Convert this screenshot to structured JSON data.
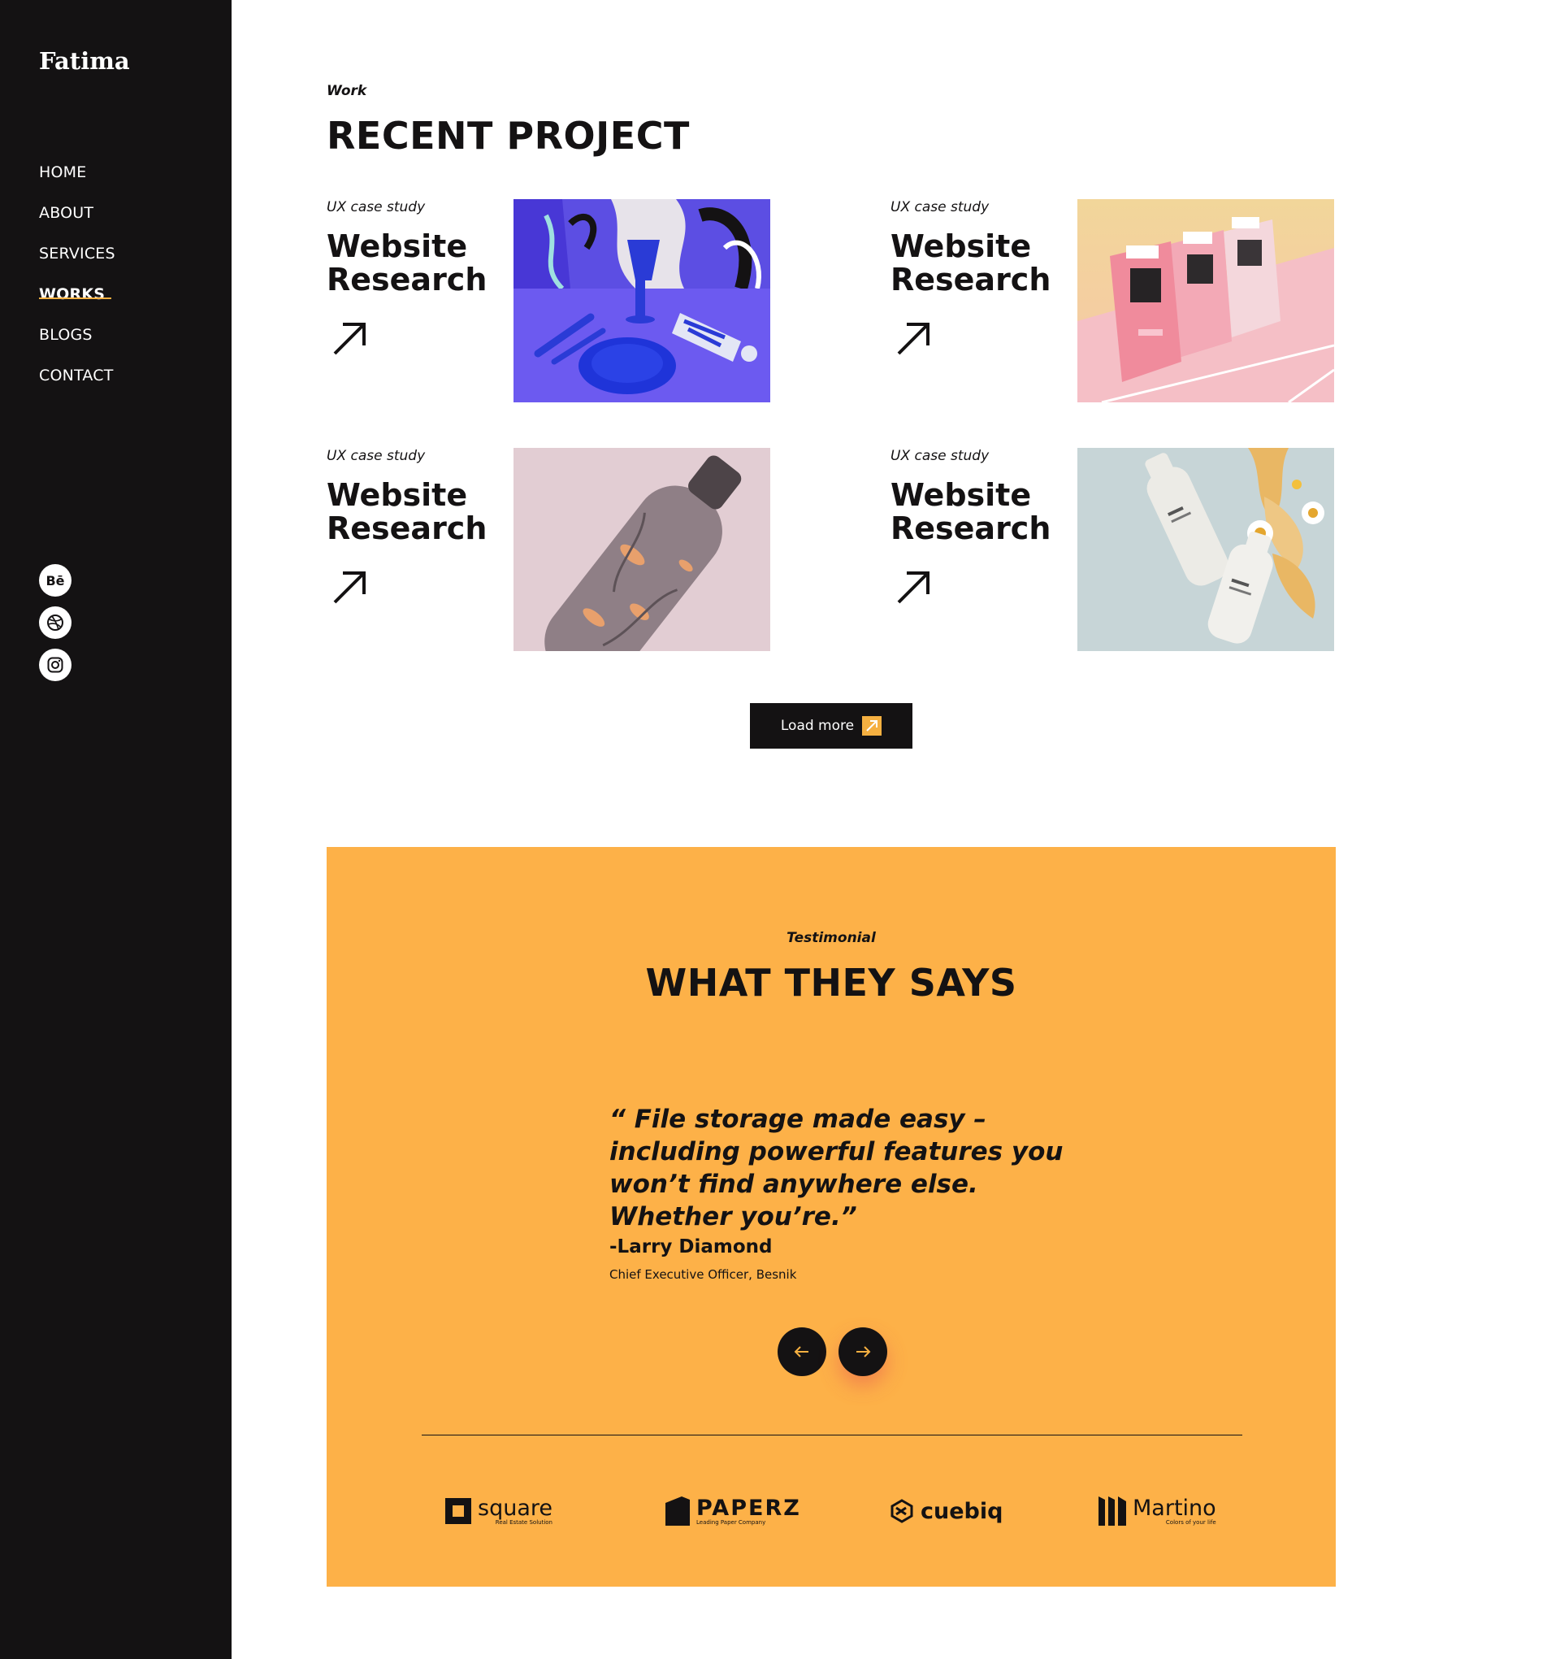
{
  "sidebar": {
    "logo": "Fatima",
    "nav": [
      "HOME",
      "ABOUT",
      "SERVICES",
      "WORKS",
      "BLOGS",
      "CONTACT"
    ],
    "active_nav": "WORKS",
    "socials": [
      {
        "label": "Bē",
        "icon": "behance-icon"
      },
      {
        "label": "",
        "icon": "dribbble-icon"
      },
      {
        "label": "",
        "icon": "instagram-icon"
      }
    ]
  },
  "work": {
    "eyebrow": "Work",
    "title": "RECENT PROJECT",
    "projects": [
      {
        "category": "UX case study",
        "title": "Website Research",
        "image": "blue-tableware-illustration"
      },
      {
        "category": "UX case study",
        "title": "Website Research",
        "image": "pink-atm-machines"
      },
      {
        "category": "UX case study",
        "title": "Website Research",
        "image": "patterned-bottle-mockup"
      },
      {
        "category": "UX case study",
        "title": "Website Research",
        "image": "cosmetic-bottles-with-flowers"
      }
    ],
    "load_more": "Load more"
  },
  "testimonial": {
    "eyebrow": "Testimonial",
    "title": "WHAT THEY SAYS",
    "quote": "“ File storage made easy – including powerful features you won’t find anywhere else. Whether you’re.”",
    "author": "-Larry Diamond",
    "role": "Chief Executive Officer, Besnik",
    "brands": [
      {
        "name": "square",
        "tagline": "Real Estate Solution"
      },
      {
        "name": "PAPERZ",
        "tagline": "Leading Paper Company"
      },
      {
        "name": "cuebiq",
        "tagline": ""
      },
      {
        "name": "Martino",
        "tagline": "Colors of your life"
      }
    ]
  },
  "colors": {
    "sidebar_bg": "#141213",
    "accent": "#f5b041",
    "testimonial_bg": "#fdb148",
    "text": "#141213"
  }
}
